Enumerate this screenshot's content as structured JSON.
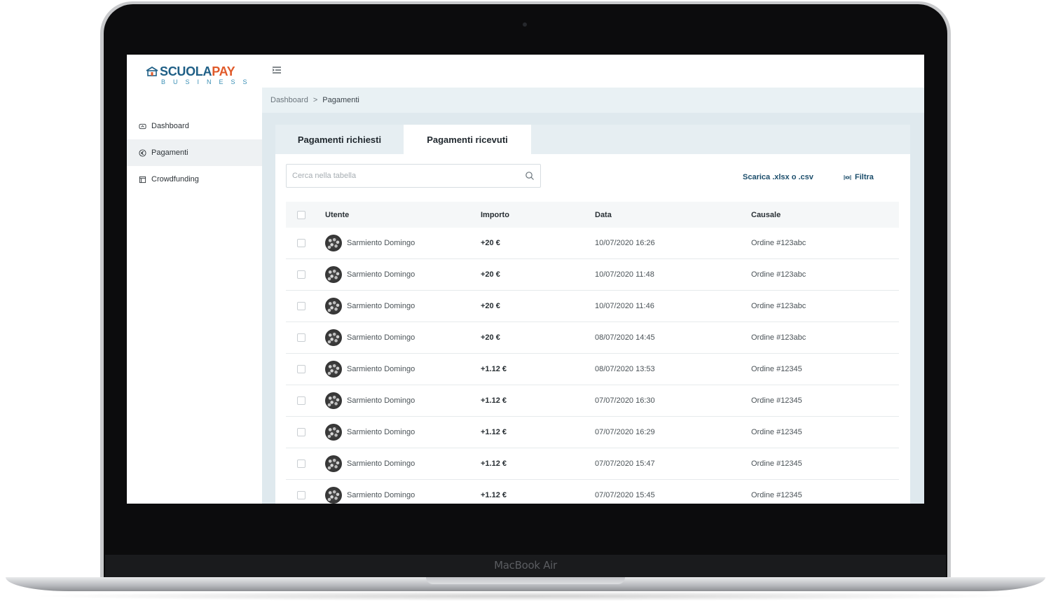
{
  "device": {
    "model_label": "MacBook Air"
  },
  "brand": {
    "name_part1": "SCUOLA",
    "name_part2": "PAY",
    "subtitle": "BUSINESS",
    "color_primary": "#1f5f86",
    "color_accent": "#e05a2a"
  },
  "sidebar": {
    "items": [
      {
        "label": "Dashboard",
        "icon": "dashboard-icon",
        "active": false
      },
      {
        "label": "Pagamenti",
        "icon": "euro-icon",
        "active": true
      },
      {
        "label": "Crowdfunding",
        "icon": "calendar-icon",
        "active": false
      }
    ]
  },
  "breadcrumb": {
    "root": "Dashboard",
    "separator": ">",
    "current": "Pagamenti"
  },
  "tabs": [
    {
      "label": "Pagamenti richiesti",
      "active": false
    },
    {
      "label": "Pagamenti ricevuti",
      "active": true
    }
  ],
  "toolbar": {
    "search_placeholder": "Cerca nella tabella",
    "download_label": "Scarica .xlsx o .csv",
    "filter_label": "Filtra"
  },
  "table": {
    "columns": [
      "Utente",
      "Importo",
      "Data",
      "Causale"
    ],
    "rows": [
      {
        "user": "Sarmiento Domingo",
        "amount": "+20 €",
        "date": "10/07/2020 16:26",
        "reason": "Ordine #123abc"
      },
      {
        "user": "Sarmiento Domingo",
        "amount": "+20 €",
        "date": "10/07/2020 11:48",
        "reason": "Ordine #123abc"
      },
      {
        "user": "Sarmiento Domingo",
        "amount": "+20 €",
        "date": "10/07/2020 11:46",
        "reason": "Ordine #123abc"
      },
      {
        "user": "Sarmiento Domingo",
        "amount": "+20 €",
        "date": "08/07/2020 14:45",
        "reason": "Ordine #123abc"
      },
      {
        "user": "Sarmiento Domingo",
        "amount": "+1.12 €",
        "date": "08/07/2020 13:53",
        "reason": "Ordine #12345"
      },
      {
        "user": "Sarmiento Domingo",
        "amount": "+1.12 €",
        "date": "07/07/2020 16:30",
        "reason": "Ordine #12345"
      },
      {
        "user": "Sarmiento Domingo",
        "amount": "+1.12 €",
        "date": "07/07/2020 16:29",
        "reason": "Ordine #12345"
      },
      {
        "user": "Sarmiento Domingo",
        "amount": "+1.12 €",
        "date": "07/07/2020 15:47",
        "reason": "Ordine #12345"
      },
      {
        "user": "Sarmiento Domingo",
        "amount": "+1.12 €",
        "date": "07/07/2020 15:45",
        "reason": "Ordine #12345"
      }
    ]
  }
}
